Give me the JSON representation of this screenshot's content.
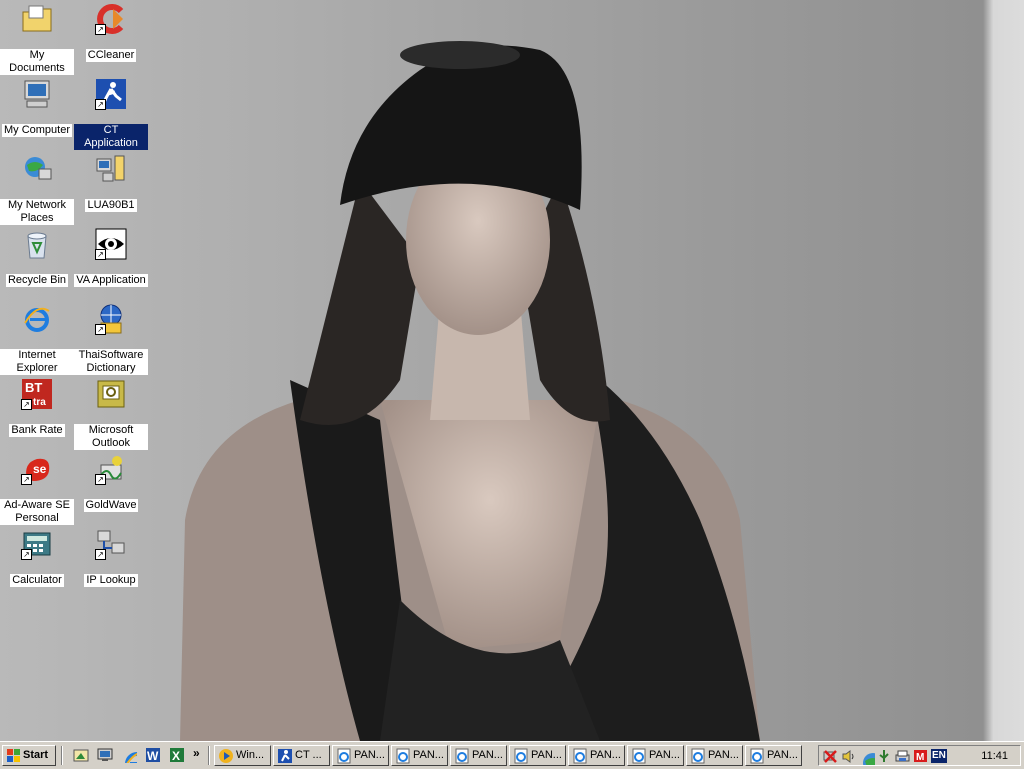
{
  "desktop": {
    "icons": [
      {
        "label": "My Documents",
        "icon": "folder-documents-icon",
        "shortcut": false
      },
      {
        "label": "CCleaner",
        "icon": "ccleaner-icon",
        "shortcut": true
      },
      {
        "label": "My Computer",
        "icon": "computer-icon",
        "shortcut": false
      },
      {
        "label": "CT Application",
        "icon": "running-man-icon",
        "shortcut": true,
        "selected": true
      },
      {
        "label": "My Network Places",
        "icon": "network-icon",
        "shortcut": false
      },
      {
        "label": "LUA90B1",
        "icon": "lua-icon",
        "shortcut": false
      },
      {
        "label": "Recycle Bin",
        "icon": "recycle-bin-icon",
        "shortcut": false
      },
      {
        "label": "VA Application",
        "icon": "eye-icon",
        "shortcut": true
      },
      {
        "label": "Internet Explorer",
        "icon": "internet-explorer-icon",
        "shortcut": false
      },
      {
        "label": "ThaiSoftware Dictionary",
        "icon": "globe-book-icon",
        "shortcut": true
      },
      {
        "label": "Bank Rate",
        "icon": "bank-rate-icon",
        "shortcut": true
      },
      {
        "label": "Microsoft Outlook",
        "icon": "outlook-icon",
        "shortcut": false
      },
      {
        "label": "Ad-Aware SE Personal",
        "icon": "adaware-icon",
        "shortcut": true
      },
      {
        "label": "GoldWave",
        "icon": "goldwave-icon",
        "shortcut": true
      },
      {
        "label": "Calculator",
        "icon": "calculator-icon",
        "shortcut": true
      },
      {
        "label": "IP Lookup",
        "icon": "network-computers-icon",
        "shortcut": true
      }
    ],
    "bank_rate_glyph": "BT",
    "bank_rate_glyph_sub": "tra"
  },
  "taskbar": {
    "start_label": "Start",
    "quick_launch_icons": [
      "show-desktop-icon",
      "monitor-icon",
      "internet-explorer-icon",
      "word-icon",
      "excel-icon"
    ],
    "overflow_label": "»",
    "tasks": [
      {
        "label": "Win...",
        "icon": "media-player-icon"
      },
      {
        "label": "CT ...",
        "icon": "ct-app-icon"
      },
      {
        "label": "PAN...",
        "icon": "ie-page-icon"
      },
      {
        "label": "PAN...",
        "icon": "ie-page-icon"
      },
      {
        "label": "PAN...",
        "icon": "ie-page-icon"
      },
      {
        "label": "PAN...",
        "icon": "ie-page-icon"
      },
      {
        "label": "PAN...",
        "icon": "ie-page-icon"
      },
      {
        "label": "PAN...",
        "icon": "ie-page-icon"
      },
      {
        "label": "PAN...",
        "icon": "ie-page-icon"
      },
      {
        "label": "PAN...",
        "icon": "ie-page-icon"
      }
    ],
    "tray": {
      "icons": [
        "network-disconnected-icon",
        "volume-icon",
        "network-icon",
        "usb-icon",
        "printer-icon",
        "antivirus-icon"
      ],
      "lang": "EN",
      "clock": "11:41"
    }
  },
  "colors": {
    "selection": "#0a246a",
    "taskbar": "#d4d0c8"
  }
}
